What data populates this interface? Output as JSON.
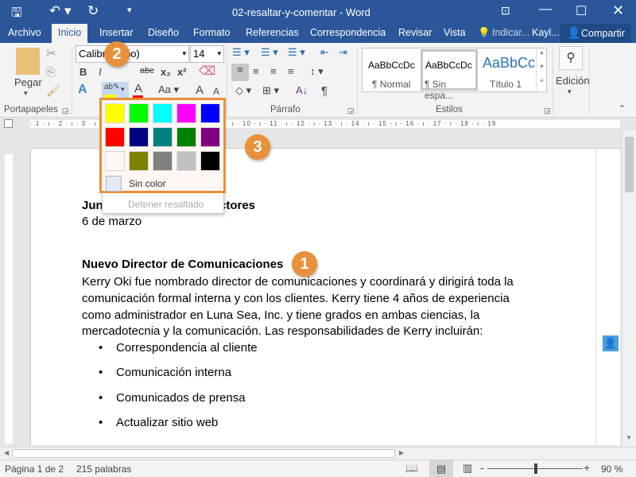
{
  "titlebar": {
    "title": "02-resaltar-y-comentar  -  Word"
  },
  "tabs": [
    {
      "label": "Archivo"
    },
    {
      "label": "Inicio"
    },
    {
      "label": "Insertar"
    },
    {
      "label": "Diseño"
    },
    {
      "label": "Formato"
    },
    {
      "label": "Referencias"
    },
    {
      "label": "Correspondencia"
    },
    {
      "label": "Revisar"
    },
    {
      "label": "Vista"
    }
  ],
  "tell_me": "Indicar...",
  "user": "Kayl...",
  "share": "Compartir",
  "ribbon": {
    "paste": "Pegar",
    "font_name": "Calibri (Cuerpo)",
    "font_name_visible": [
      "Calibr",
      "po)"
    ],
    "font_size": "14",
    "groups": {
      "clipboard": "Portapapeles",
      "paragraph": "Párrafo",
      "styles": "Estilos"
    },
    "styles": [
      {
        "preview": "AaBbCcDc",
        "name": "¶ Normal"
      },
      {
        "preview": "AaBbCcDc",
        "name": "¶ Sin espa..."
      },
      {
        "preview": "AaBbCc",
        "name": "Título 1"
      }
    ],
    "editing": "Edición"
  },
  "highlight_menu": {
    "colors": [
      "#ffff00",
      "#00ff00",
      "#00ffff",
      "#ff00ff",
      "#0000ff",
      "#ff0000",
      "#000080",
      "#008080",
      "#008000",
      "#800080",
      "#fdf8f4",
      "#808000",
      "#808080",
      "#c0c0c0",
      "#000000"
    ],
    "no_color": "Sin color",
    "stop": "Detener resaltado"
  },
  "document": {
    "heading_fragments": [
      "Jun",
      "ctores"
    ],
    "date": "6 de marzo",
    "subheading": "Nuevo Director de Comunicaciones",
    "paragraph": [
      "Kerry Oki fue nombrado director de comunicaciones y coordinará y dirigirá toda la",
      "comunicación formal interna y con los clientes. Kerry tiene 4 años de experiencia",
      "como administrador en Luna Sea, Inc. y tiene grados en ambas ciencias, la",
      "mercadotecnia y la comunicación. Las responsabilidades de Kerry incluirán:"
    ],
    "bullets": [
      "Correspondencia al cliente",
      "Comunicación interna",
      "Comunicados de prensa",
      "Actualizar sitio web"
    ]
  },
  "status": {
    "page": "Página 1 de 2",
    "words": "215 palabras",
    "zoom": "90 %"
  },
  "callouts": [
    "1",
    "2",
    "3"
  ],
  "colors": {
    "accent": "#2b579a",
    "callout": "#e8903a"
  }
}
